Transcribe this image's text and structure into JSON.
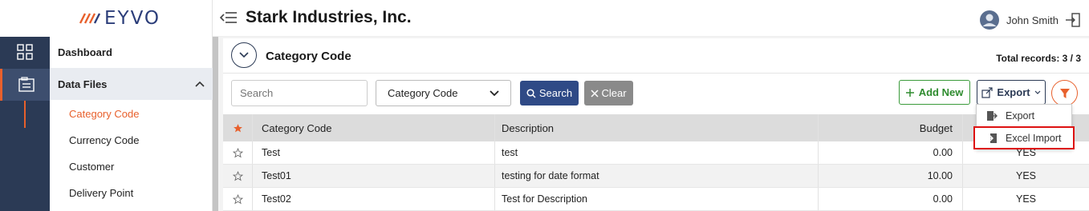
{
  "brand": {
    "logo_text": "EYVO",
    "accent": "#e8602c",
    "primary": "#2b3a55"
  },
  "header": {
    "company": "Stark Industries, Inc.",
    "user_name": "John Smith"
  },
  "rail": {
    "icons": [
      "grid-icon",
      "data-files-icon"
    ]
  },
  "sidebar": {
    "dashboard": "Dashboard",
    "group": "Data Files",
    "items": [
      {
        "label": "Category Code"
      },
      {
        "label": "Currency Code"
      },
      {
        "label": "Customer"
      },
      {
        "label": "Delivery Point"
      }
    ]
  },
  "page": {
    "title": "Category Code",
    "total_records": "Total records: 3 / 3"
  },
  "filters": {
    "search_placeholder": "Search",
    "select_value": "Category Code",
    "search_button": "Search",
    "clear_button": "Clear",
    "add_button": "Add New",
    "export_button": "Export"
  },
  "table": {
    "headers": {
      "code": "Category Code",
      "description": "Description",
      "budget": "Budget"
    },
    "rows": [
      {
        "code": "Test",
        "description": "test",
        "budget": "0.00",
        "active": "YES"
      },
      {
        "code": "Test01",
        "description": "testing for date format",
        "budget": "10.00",
        "active": "YES"
      },
      {
        "code": "Test02",
        "description": "Test for Description",
        "budget": "0.00",
        "active": "YES"
      }
    ]
  },
  "export_menu": {
    "items": [
      {
        "label": "Export",
        "icon": "export-file-icon"
      },
      {
        "label": "Excel Import",
        "icon": "import-file-icon"
      }
    ]
  }
}
